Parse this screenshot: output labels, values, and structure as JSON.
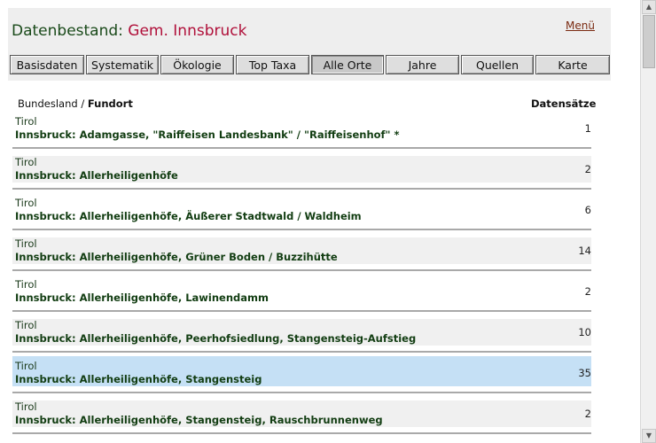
{
  "header": {
    "label": "Datenbestand:",
    "place": "Gem. Innsbruck",
    "menu_link": "Menü"
  },
  "tabs": [
    {
      "label": "Basisdaten",
      "active": false
    },
    {
      "label": "Systematik",
      "active": false
    },
    {
      "label": "Ökologie",
      "active": false
    },
    {
      "label": "Top Taxa",
      "active": false
    },
    {
      "label": "Alle Orte",
      "active": true
    },
    {
      "label": "Jahre",
      "active": false
    },
    {
      "label": "Quellen",
      "active": false
    },
    {
      "label": "Karte",
      "active": false
    }
  ],
  "columns": {
    "state_label": "Bundesland",
    "separator": "/",
    "place_label": "Fundort",
    "count_label": "Datensätze"
  },
  "rows": [
    {
      "state": "Tirol",
      "place": "Innsbruck: Adamgasse, \"Raiffeisen Landesbank\" / \"Raiffeisenhof\" *",
      "count": "1"
    },
    {
      "state": "Tirol",
      "place": "Innsbruck: Allerheiligenhöfe",
      "count": "2"
    },
    {
      "state": "Tirol",
      "place": "Innsbruck: Allerheiligenhöfe, Äußerer Stadtwald / Waldheim",
      "count": "6"
    },
    {
      "state": "Tirol",
      "place": "Innsbruck: Allerheiligenhöfe, Grüner Boden / Buzzihütte",
      "count": "14"
    },
    {
      "state": "Tirol",
      "place": "Innsbruck: Allerheiligenhöfe, Lawinendamm",
      "count": "2"
    },
    {
      "state": "Tirol",
      "place": "Innsbruck: Allerheiligenhöfe, Peerhofsiedlung, Stangensteig-Aufstieg",
      "count": "10"
    },
    {
      "state": "Tirol",
      "place": "Innsbruck: Allerheiligenhöfe, Stangensteig",
      "count": "35"
    },
    {
      "state": "Tirol",
      "place": "Innsbruck: Allerheiligenhöfe, Stangensteig, Rauschbrunnenweg",
      "count": "2"
    }
  ],
  "selected_row": 6,
  "colors": {
    "title_green": "#1a4a1a",
    "place_red": "#b0103a",
    "selected_row": "#c5e0f5",
    "alt_row": "#f0f0f0"
  },
  "icons": {
    "scroll_up": "chevron-up-icon",
    "scroll_down": "chevron-down-icon"
  }
}
